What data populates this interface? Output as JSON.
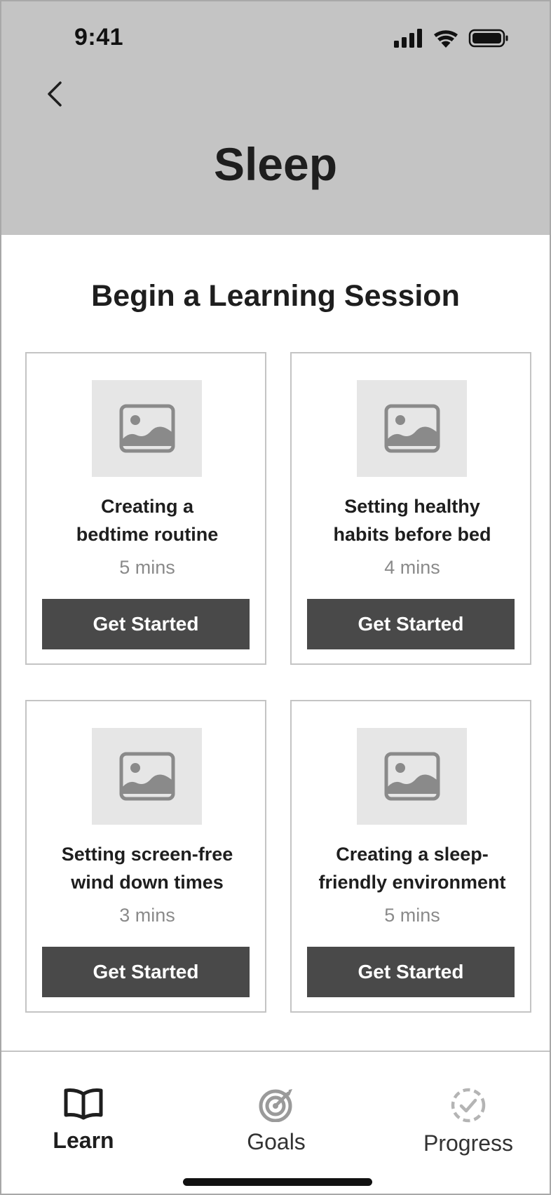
{
  "status_bar": {
    "time": "9:41",
    "icons": [
      "cellular-signal-icon",
      "wifi-icon",
      "battery-icon"
    ]
  },
  "header": {
    "back_icon": "chevron-left-icon",
    "title": "Sleep",
    "background": "#c4c4c4"
  },
  "main": {
    "section_title": "Begin a Learning Session",
    "sessions": [
      {
        "title_line1": "Creating a",
        "title_line2": "bedtime routine",
        "duration": "5 mins",
        "button_label": "Get Started",
        "image_icon": "image-placeholder-icon"
      },
      {
        "title_line1": "Setting healthy",
        "title_line2": "habits before bed",
        "duration": "4 mins",
        "button_label": "Get Started",
        "image_icon": "image-placeholder-icon"
      },
      {
        "title_line1": "Setting screen-free",
        "title_line2": "wind down times",
        "duration": "3 mins",
        "button_label": "Get Started",
        "image_icon": "image-placeholder-icon"
      },
      {
        "title_line1": "Creating a sleep-",
        "title_line2": "friendly environment",
        "duration": "5 mins",
        "button_label": "Get Started",
        "image_icon": "image-placeholder-icon"
      }
    ],
    "button_color": "#494949"
  },
  "tab_bar": {
    "tabs": [
      {
        "label": "Learn",
        "icon": "open-book-icon",
        "active": true
      },
      {
        "label": "Goals",
        "icon": "target-icon",
        "active": false
      },
      {
        "label": "Progress",
        "icon": "dashed-check-circle-icon",
        "active": false
      }
    ]
  }
}
